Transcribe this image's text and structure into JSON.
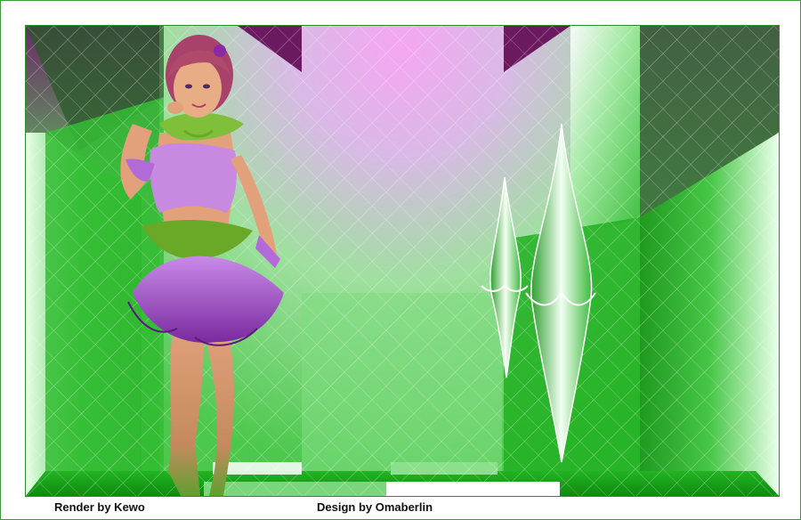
{
  "credits": {
    "render": "Render by Kewo",
    "design": "Design by Omaberlin"
  },
  "palette": {
    "green_dark": "#1f9a1f",
    "green_mid": "#3cc43c",
    "green_light": "#bff3bf",
    "magenta": "#e26ee6",
    "purple_dark": "#6a1a5e",
    "violet": "#b86ad8",
    "skin": "#e6a57a",
    "hair": "#b04a6a"
  }
}
